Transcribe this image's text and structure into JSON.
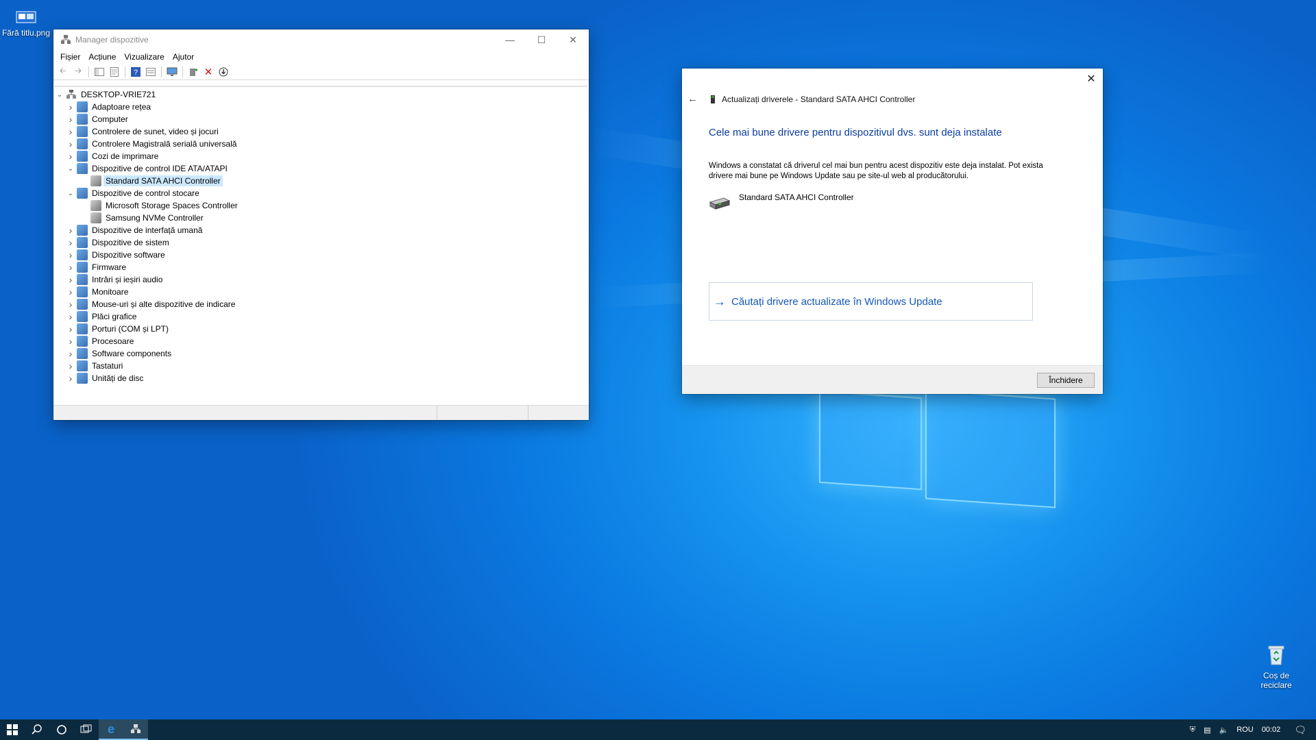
{
  "desktop": {
    "icons": [
      {
        "label": "Fără titlu.png",
        "icon": "image-file-icon"
      },
      {
        "label": "Coș de reciclare",
        "icon": "recycle-bin-icon"
      }
    ]
  },
  "device_manager": {
    "title": "Manager dispozitive",
    "menu": [
      "Fișier",
      "Acțiune",
      "Vizualizare",
      "Ajutor"
    ],
    "toolbar": [
      "back-icon",
      "forward-icon",
      "show-hide-tree-icon",
      "properties-icon",
      "help-icon",
      "view-icon",
      "monitor-icon",
      "add-driver-icon",
      "uninstall-icon",
      "download-icon"
    ],
    "tree": {
      "root": "DESKTOP-VRIE721",
      "nodes": [
        {
          "label": "Adaptoare rețea",
          "expanded": false
        },
        {
          "label": "Computer",
          "expanded": false
        },
        {
          "label": "Controlere de sunet, video și jocuri",
          "expanded": false
        },
        {
          "label": "Controlere Magistrală serială universală",
          "expanded": false
        },
        {
          "label": "Cozi de imprimare",
          "expanded": false
        },
        {
          "label": "Dispozitive de control IDE ATA/ATAPI",
          "expanded": true,
          "children": [
            "Standard SATA AHCI Controller"
          ]
        },
        {
          "label": "Dispozitive de control stocare",
          "expanded": true,
          "children": [
            "Microsoft Storage Spaces Controller",
            "Samsung NVMe Controller"
          ]
        },
        {
          "label": "Dispozitive de interfață umană",
          "expanded": false
        },
        {
          "label": "Dispozitive de sistem",
          "expanded": false
        },
        {
          "label": "Dispozitive software",
          "expanded": false
        },
        {
          "label": "Firmware",
          "expanded": false
        },
        {
          "label": "Intrări și ieșiri audio",
          "expanded": false
        },
        {
          "label": "Monitoare",
          "expanded": false
        },
        {
          "label": "Mouse-uri și alte dispozitive de indicare",
          "expanded": false
        },
        {
          "label": "Plăci grafice",
          "expanded": false
        },
        {
          "label": "Porturi (COM și LPT)",
          "expanded": false
        },
        {
          "label": "Procesoare",
          "expanded": false
        },
        {
          "label": "Software components",
          "expanded": false
        },
        {
          "label": "Tastaturi",
          "expanded": false
        },
        {
          "label": "Unități de disc",
          "expanded": false
        }
      ],
      "selected": "Standard SATA AHCI Controller"
    }
  },
  "update_dialog": {
    "header": "Actualizați driverele - Standard SATA AHCI Controller",
    "title": "Cele mai bune drivere pentru dispozitivul dvs. sunt deja instalate",
    "body": "Windows a constatat că driverul cel mai bun pentru acest dispozitiv este deja instalat. Pot exista drivere mai bune pe Windows Update sau pe site-ul web al producătorului.",
    "device_name": "Standard SATA AHCI Controller",
    "link": "Căutați drivere actualizate în Windows Update",
    "close_button": "Închidere"
  },
  "taskbar": {
    "language": "ROU",
    "time": "00:02"
  }
}
